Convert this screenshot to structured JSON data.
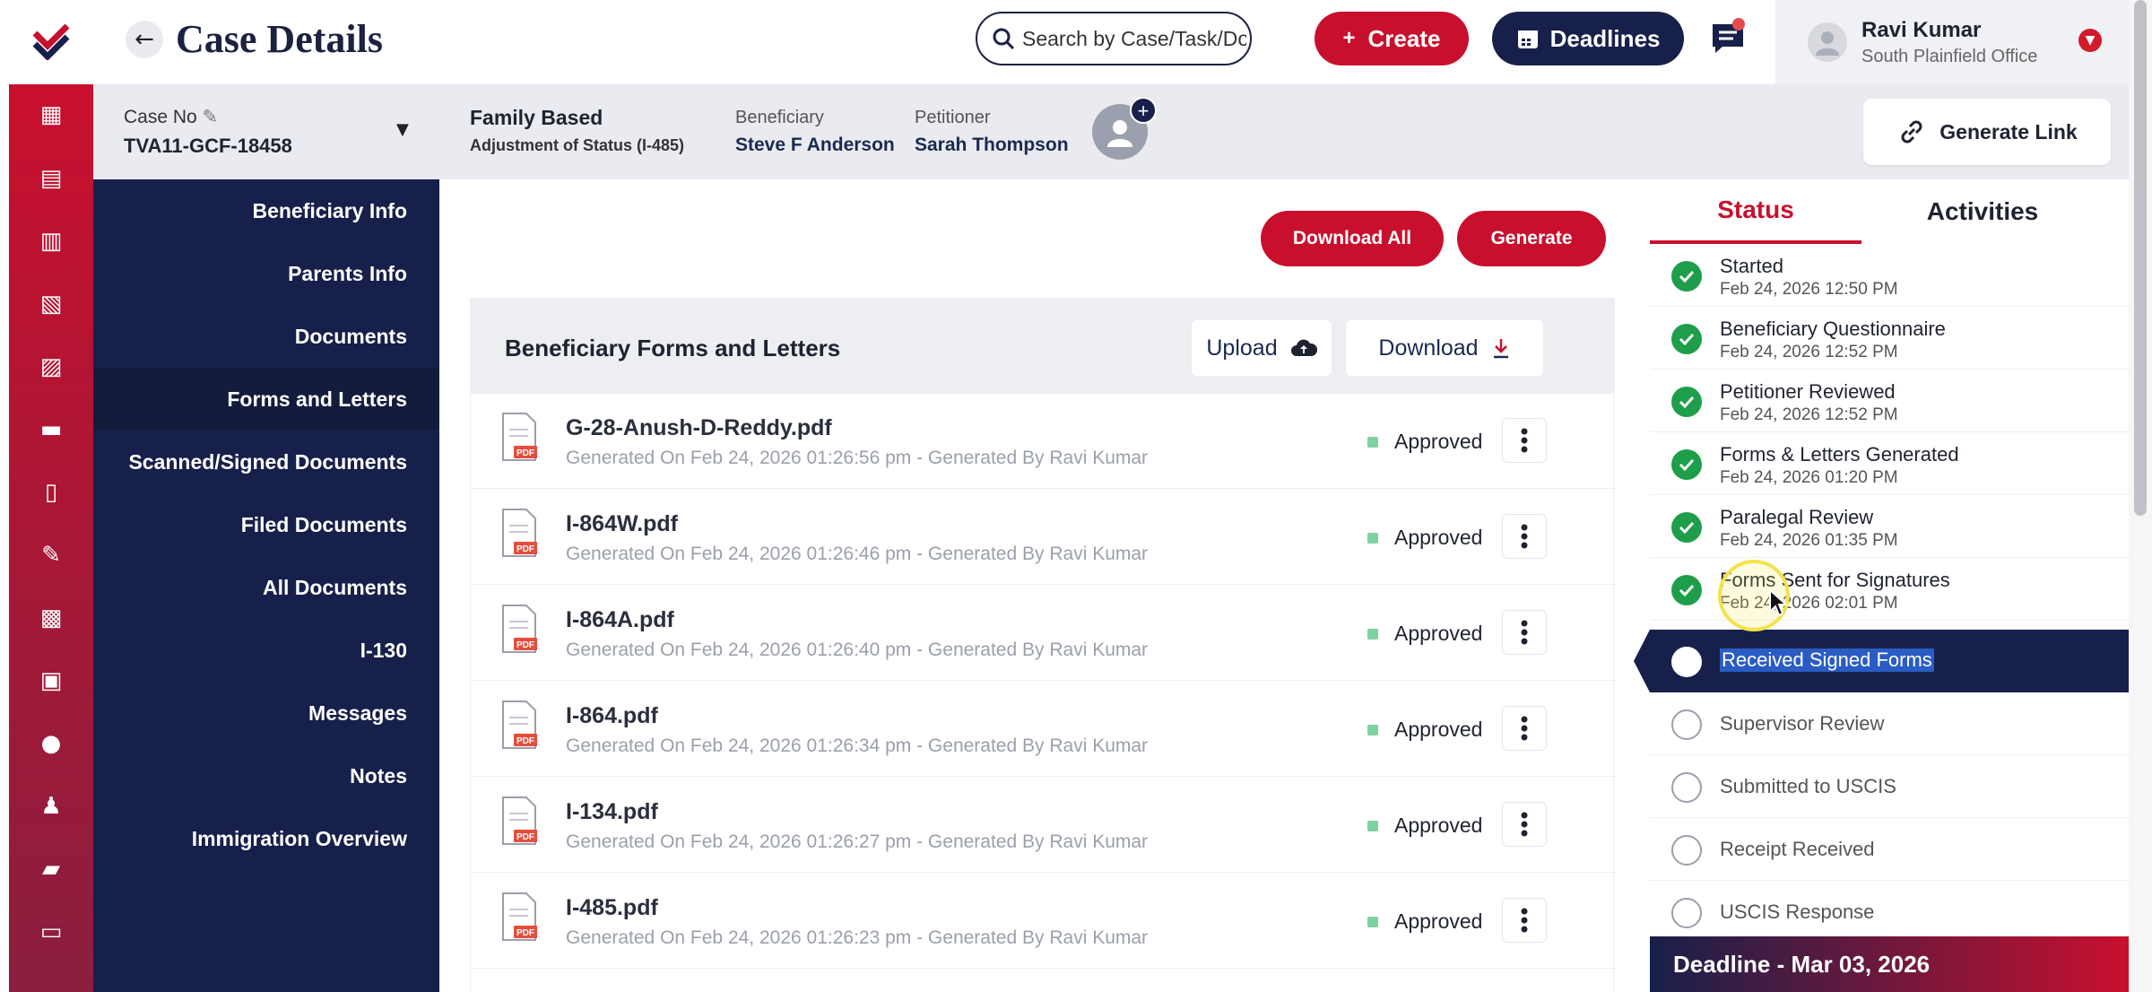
{
  "header": {
    "title": "Case Details",
    "search_placeholder": "Search by Case/Task/Document",
    "create_label": "Create",
    "deadlines_label": "Deadlines",
    "user": {
      "name": "Ravi Kumar",
      "office": "South Plainfield Office"
    }
  },
  "case": {
    "no_label": "Case No",
    "no_value": "TVA11-GCF-18458",
    "type": "Family Based",
    "subtype": "Adjustment of Status (I-485)",
    "beneficiary_label": "Beneficiary",
    "beneficiary_name": "Steve F Anderson",
    "petitioner_label": "Petitioner",
    "petitioner_name": "Sarah Thompson",
    "generate_link_label": "Generate Link"
  },
  "nav": {
    "items": [
      {
        "label": "Beneficiary Info"
      },
      {
        "label": "Parents Info"
      },
      {
        "label": "Documents"
      },
      {
        "label": "Forms and Letters"
      },
      {
        "label": "Scanned/Signed Documents"
      },
      {
        "label": "Filed Documents"
      },
      {
        "label": "All Documents"
      },
      {
        "label": "I-130"
      },
      {
        "label": "Messages"
      },
      {
        "label": "Notes"
      },
      {
        "label": "Immigration Overview"
      }
    ]
  },
  "main": {
    "download_all_label": "Download All",
    "generate_label": "Generate",
    "forms_title": "Beneficiary Forms and Letters",
    "upload_label": "Upload",
    "download_label": "Download",
    "icon_badge": "PDF",
    "documents": [
      {
        "name": "G-28-Anush-D-Reddy.pdf",
        "meta": "Generated On Feb 24, 2026 01:26:56 pm - Generated By Ravi Kumar",
        "status": "Approved"
      },
      {
        "name": "I-864W.pdf",
        "meta": "Generated On Feb 24, 2026 01:26:46 pm - Generated By Ravi Kumar",
        "status": "Approved"
      },
      {
        "name": "I-864A.pdf",
        "meta": "Generated On Feb 24, 2026 01:26:40 pm - Generated By Ravi Kumar",
        "status": "Approved"
      },
      {
        "name": "I-864.pdf",
        "meta": "Generated On Feb 24, 2026 01:26:34 pm - Generated By Ravi Kumar",
        "status": "Approved"
      },
      {
        "name": "I-134.pdf",
        "meta": "Generated On Feb 24, 2026 01:26:27 pm - Generated By Ravi Kumar",
        "status": "Approved"
      },
      {
        "name": "I-485.pdf",
        "meta": "Generated On Feb 24, 2026 01:26:23 pm - Generated By Ravi Kumar",
        "status": "Approved"
      }
    ]
  },
  "status_panel": {
    "tab_status": "Status",
    "tab_activities": "Activities",
    "steps": [
      {
        "name": "Started",
        "date": "Feb 24, 2026 12:50 PM",
        "state": "done"
      },
      {
        "name": "Beneficiary Questionnaire",
        "date": "Feb 24, 2026 12:52 PM",
        "state": "done"
      },
      {
        "name": "Petitioner Reviewed",
        "date": "Feb 24, 2026 12:52 PM",
        "state": "done"
      },
      {
        "name": "Forms & Letters Generated",
        "date": "Feb 24, 2026 01:20 PM",
        "state": "done"
      },
      {
        "name": "Paralegal Review",
        "date": "Feb 24, 2026 01:35 PM",
        "state": "done"
      },
      {
        "name": "Forms Sent for Signatures",
        "date": "Feb 24, 2026 02:01 PM",
        "state": "done"
      },
      {
        "name": "Received Signed Forms",
        "date": "",
        "state": "current"
      },
      {
        "name": "Supervisor Review",
        "date": "",
        "state": "pending"
      },
      {
        "name": "Submitted to USCIS",
        "date": "",
        "state": "pending"
      },
      {
        "name": "Receipt Received",
        "date": "",
        "state": "pending"
      },
      {
        "name": "USCIS Response",
        "date": "",
        "state": "pending"
      }
    ],
    "deadline": "Deadline - Mar 03, 2026"
  },
  "colors": {
    "brand_red": "#c8102e",
    "navy": "#17204a",
    "success": "#1e9e4a"
  },
  "icons": [
    "dashboard-icon",
    "document-icon",
    "form-icon",
    "form-settings-icon",
    "form-check-icon",
    "message-icon",
    "notebook-icon",
    "edit-icon",
    "calendar-icon",
    "clipboard-icon",
    "user-icon",
    "person-icon",
    "folder-icon",
    "chat-icon"
  ]
}
